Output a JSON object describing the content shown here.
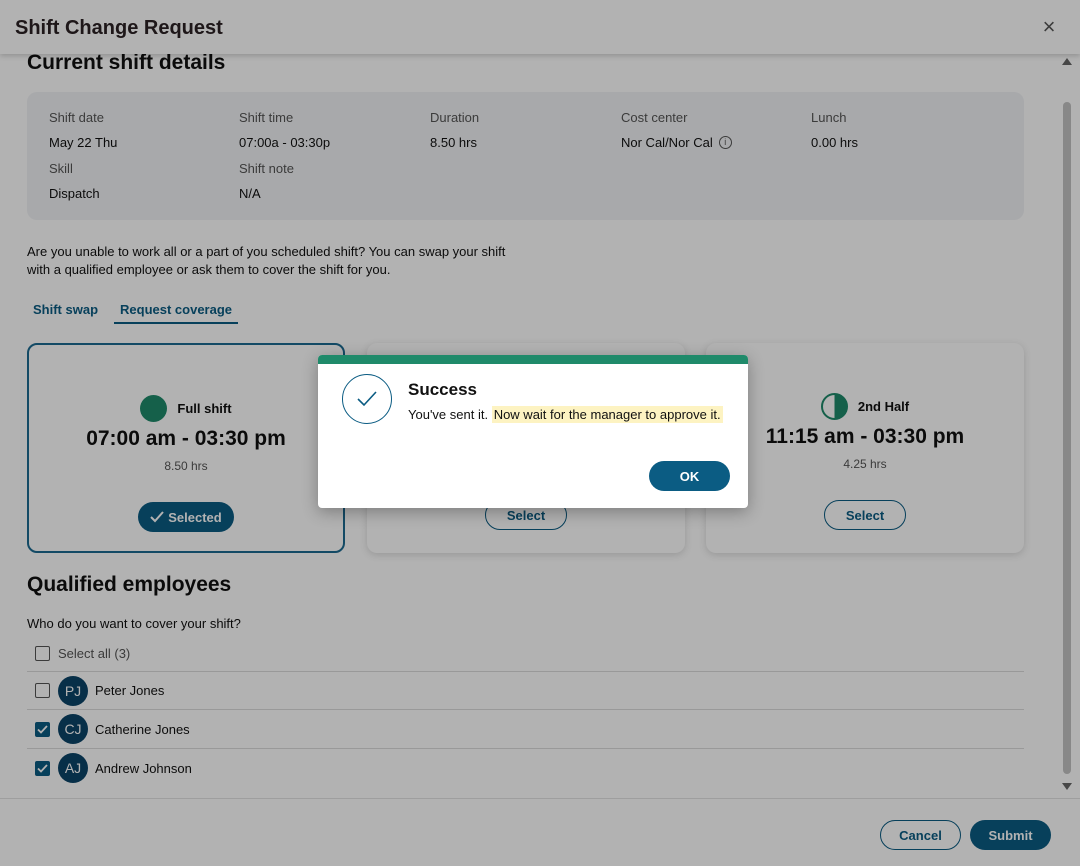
{
  "header": {
    "title": "Shift Change Request",
    "close_icon": "×"
  },
  "current_shift": {
    "section_title": "Current shift details",
    "fields": {
      "shift_date": {
        "label": "Shift date",
        "value": "May 22 Thu"
      },
      "shift_time": {
        "label": "Shift time",
        "value": "07:00a - 03:30p"
      },
      "duration": {
        "label": "Duration",
        "value": "8.50 hrs"
      },
      "cost_center": {
        "label": "Cost center",
        "value": "Nor Cal/Nor Cal"
      },
      "lunch": {
        "label": "Lunch",
        "value": "0.00 hrs"
      },
      "skill": {
        "label": "Skill",
        "value": "Dispatch"
      },
      "shift_note": {
        "label": "Shift note",
        "value": "N/A"
      }
    }
  },
  "intro_text": "Are you unable to work all or a part of you scheduled shift? You can swap your shift with a qualified employee or ask them to cover the shift for you.",
  "tabs": [
    {
      "label": "Shift swap",
      "active": false
    },
    {
      "label": "Request coverage",
      "active": true
    }
  ],
  "options": [
    {
      "name": "Full shift",
      "time": "07:00 am - 03:30 pm",
      "duration": "8.50 hrs",
      "button": "Selected",
      "selected": true,
      "icon": "full-circle-icon"
    },
    {
      "name": "",
      "time": "",
      "duration": "",
      "button": "Select",
      "selected": false,
      "icon": ""
    },
    {
      "name": "2nd Half",
      "time": "11:15 am - 03:30 pm",
      "duration": "4.25 hrs",
      "button": "Select",
      "selected": false,
      "icon": "half-circle-icon"
    }
  ],
  "qualified": {
    "section_title": "Qualified employees",
    "question": "Who do you want to cover your shift?",
    "select_all_label": "Select all (3)",
    "employees": [
      {
        "initials": "PJ",
        "name": "Peter Jones",
        "checked": false
      },
      {
        "initials": "CJ",
        "name": "Catherine Jones",
        "checked": true
      },
      {
        "initials": "AJ",
        "name": "Andrew Johnson",
        "checked": true
      }
    ]
  },
  "footer": {
    "cancel_label": "Cancel",
    "submit_label": "Submit"
  },
  "dialog": {
    "title": "Success",
    "message_plain": "You've sent it.",
    "message_highlight": "Now wait for the manager to approve it.",
    "ok_label": "OK"
  },
  "colors": {
    "brand": "#0b5c83",
    "success": "#1f8a6a",
    "highlight": "#fdf3c2",
    "avatar": "#0b4468"
  }
}
